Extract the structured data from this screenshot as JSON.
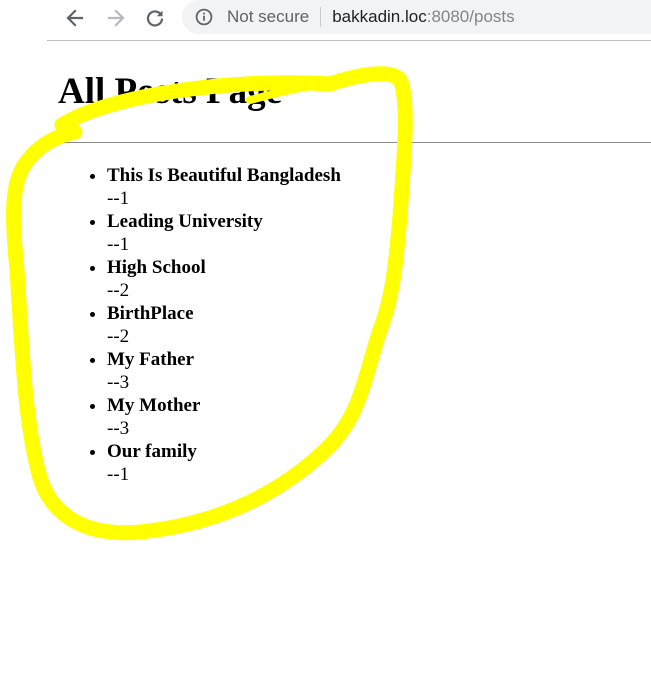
{
  "browser": {
    "security_label": "Not secure",
    "url_host": "bakkadin.loc",
    "url_rest": ":8080/posts"
  },
  "page": {
    "title": "All Posts Page",
    "posts": [
      {
        "title": "This Is Beautiful Bangladesh",
        "count": "--1"
      },
      {
        "title": "Leading University",
        "count": "--1"
      },
      {
        "title": "High School",
        "count": "--2"
      },
      {
        "title": "BirthPlace",
        "count": "--2"
      },
      {
        "title": "My Father",
        "count": "--3"
      },
      {
        "title": "My Mother",
        "count": "--3"
      },
      {
        "title": "Our family",
        "count": "--1"
      }
    ]
  },
  "colors": {
    "highlight": "#ffff00",
    "omnibox_bg": "#f1f3f4",
    "chrome_icon": "#5f6368"
  },
  "icons": [
    "back-arrow-icon",
    "forward-arrow-icon",
    "reload-icon",
    "info-icon"
  ]
}
